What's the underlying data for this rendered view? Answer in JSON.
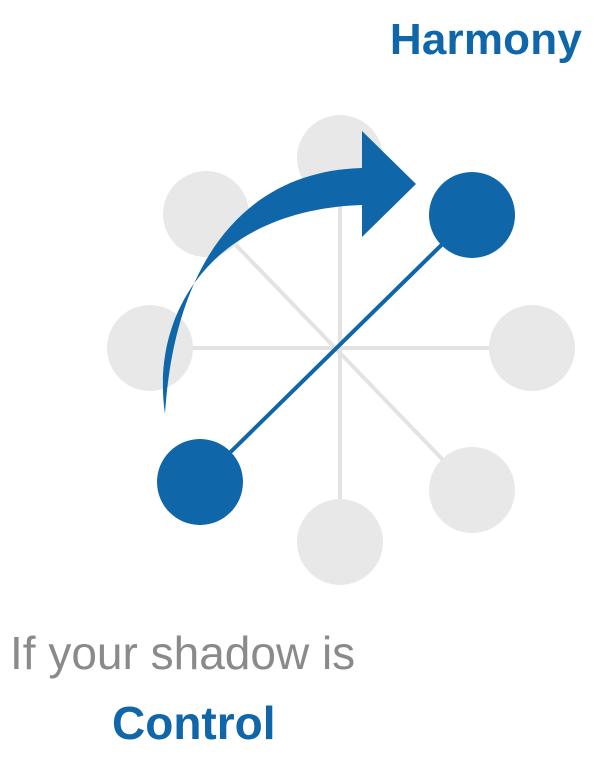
{
  "title": "Harmony",
  "caption": "If your shadow is",
  "subcaption": "Control",
  "colors": {
    "accent": "#0f66a8",
    "muted": "#e8e8e8",
    "spoke": "#e3e3e3",
    "caption_gray": "#8a8a8a"
  },
  "icons": {
    "arrow": "curved-arrow-icon"
  }
}
